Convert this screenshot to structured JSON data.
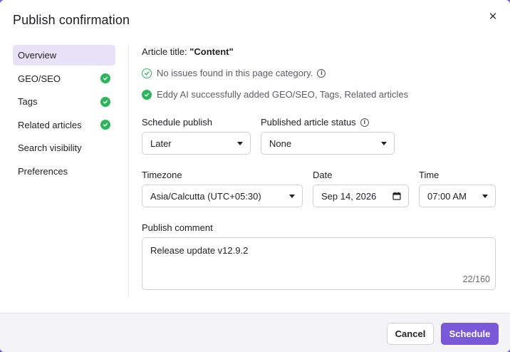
{
  "dialog": {
    "title": "Publish confirmation",
    "close_icon": "close-icon"
  },
  "sidebar": {
    "items": [
      {
        "label": "Overview",
        "active": true,
        "checked": false
      },
      {
        "label": "GEO/SEO",
        "active": false,
        "checked": true
      },
      {
        "label": "Tags",
        "active": false,
        "checked": true
      },
      {
        "label": "Related articles",
        "active": false,
        "checked": true
      },
      {
        "label": "Search visibility",
        "active": false,
        "checked": false
      },
      {
        "label": "Preferences",
        "active": false,
        "checked": false
      }
    ]
  },
  "overview": {
    "article_title_label": "Article title:",
    "article_title_value": "\"Content\"",
    "status_1": "No issues found in this page category.",
    "status_2": "Eddy AI successfully added GEO/SEO, Tags, Related articles"
  },
  "form": {
    "schedule_publish": {
      "label": "Schedule publish",
      "value": "Later"
    },
    "article_status": {
      "label": "Published article status",
      "value": "None"
    },
    "timezone": {
      "label": "Timezone",
      "value": "Asia/Calcutta (UTC+05:30)"
    },
    "date": {
      "label": "Date",
      "value": "Sep 14, 2026"
    },
    "time": {
      "label": "Time",
      "value": "07:00 AM"
    },
    "comment": {
      "label": "Publish comment",
      "value": "Release update v12.9.2",
      "counter": "22/160"
    }
  },
  "footer": {
    "cancel_label": "Cancel",
    "schedule_label": "Schedule"
  },
  "colors": {
    "accent": "#7a59d8",
    "success": "#2db55d",
    "nav_active_bg": "#e7e2f8"
  }
}
